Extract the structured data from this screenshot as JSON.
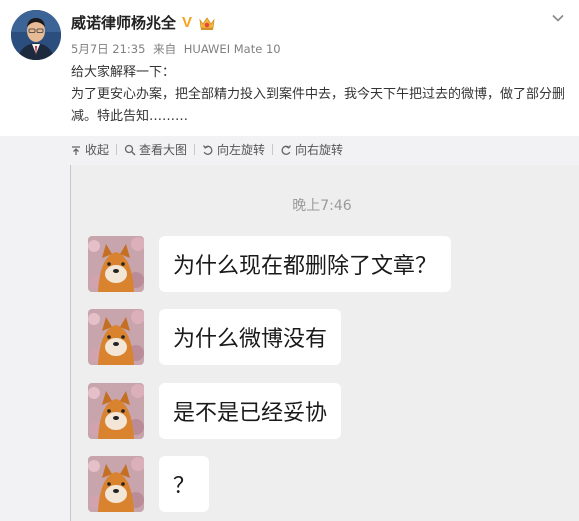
{
  "post": {
    "username": "威诺律师杨兆全",
    "verified_badge": "V",
    "meta": {
      "date": "5月7日 21:35",
      "source_prefix": "来自",
      "device": "HUAWEI Mate 10"
    },
    "text_line1": "给大家解释一下：",
    "text_line2": "为了更安心办案，把全部精力投入到案件中去，我今天下午把过去的微博，做了部分删减。特此告知………"
  },
  "toolbar": {
    "collapse": "收起",
    "view_large": "查看大图",
    "rotate_left": "向左旋转",
    "rotate_right": "向右旋转"
  },
  "chat": {
    "time": "晚上7:46",
    "messages": [
      {
        "text": "为什么现在都删除了文章？"
      },
      {
        "text": "为什么微博没有"
      },
      {
        "text": "是不是已经妥协"
      },
      {
        "text": "？"
      }
    ]
  },
  "icons": {
    "avatar": "lawyer-portrait",
    "badge": "verified-v-icon",
    "crown": "vip-crown-icon",
    "menu": "chevron-down-icon",
    "collapse": "arrow-up-icon",
    "zoom": "search-icon",
    "rotate_left": "rotate-left-icon",
    "rotate_right": "rotate-right-icon"
  },
  "colors": {
    "accent_badge": "#f8a21c",
    "toolbar_bg": "#f2f2f5",
    "chat_bg": "#eeeeee",
    "bubble_bg": "#ffffff"
  }
}
